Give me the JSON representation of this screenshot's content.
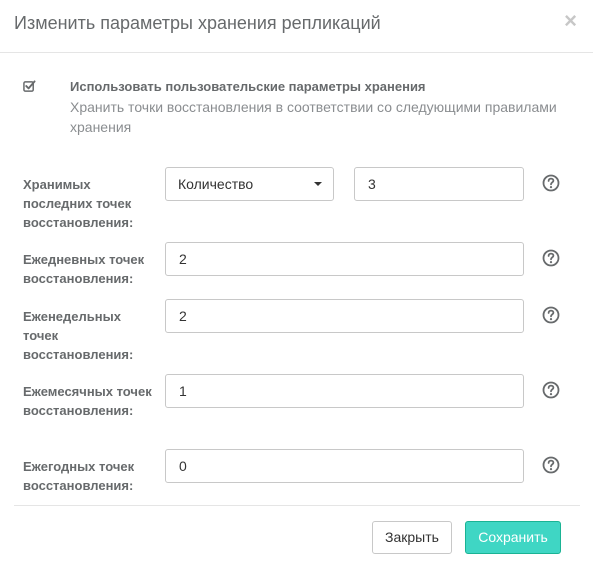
{
  "dialog": {
    "title": "Изменить параметры хранения репликаций",
    "close_symbol": "×"
  },
  "custom_retention": {
    "checked": true,
    "title": "Использовать пользовательские параметры хранения",
    "description": "Хранить точки восстановления в соответствии со следующими правилами хранения"
  },
  "fields": {
    "last_points": {
      "label": "Хранимых последних точек восстановления:",
      "mode": "Количество",
      "value": "3"
    },
    "daily": {
      "label": "Ежедневных точек восстановления:",
      "value": "2"
    },
    "weekly": {
      "label": "Еженедельных точек восстановления:",
      "value": "2"
    },
    "monthly": {
      "label": "Ежемесячных точек восстановления:",
      "value": "1"
    },
    "yearly": {
      "label": "Ежегодных точек восстановления:",
      "value": "0"
    }
  },
  "footer": {
    "close_label": "Закрыть",
    "save_label": "Сохранить"
  },
  "colors": {
    "save_button": "#3fd6c4",
    "help_icon": "#676a6c"
  },
  "icons": {
    "checkbox": "check-square-icon",
    "help": "question-circle-icon",
    "close": "close-icon"
  }
}
